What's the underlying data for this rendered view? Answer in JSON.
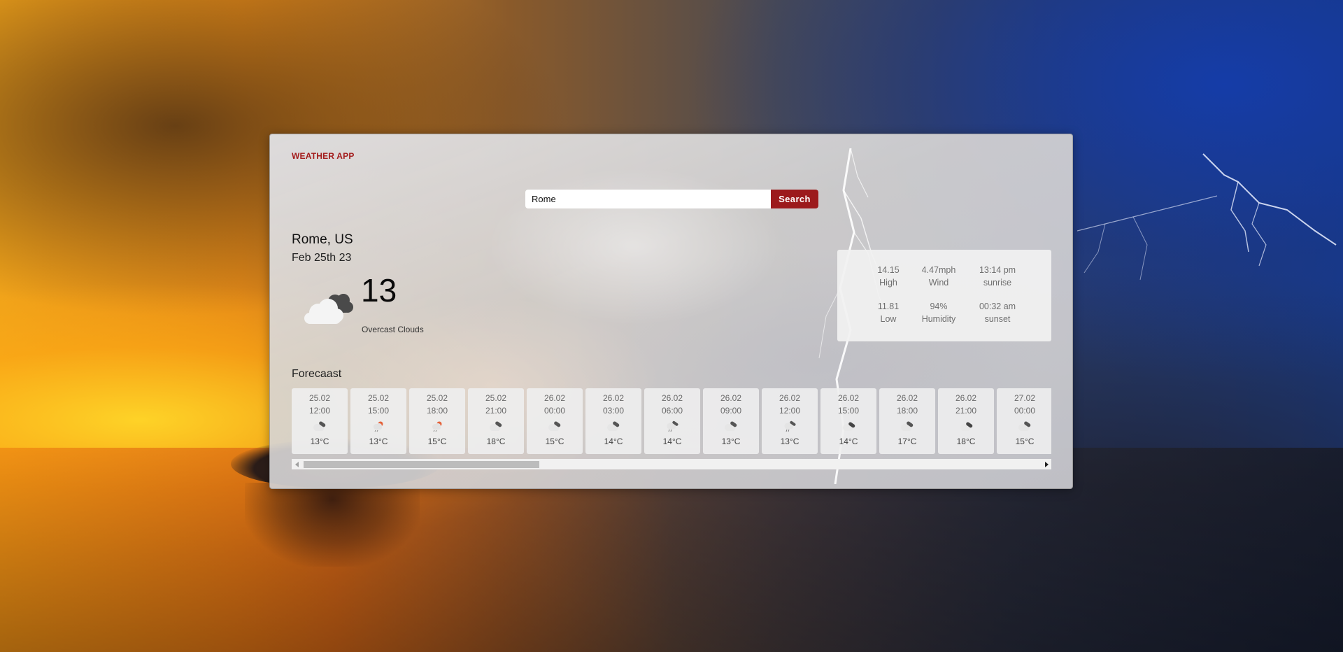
{
  "app": {
    "title": "WEATHER APP"
  },
  "search": {
    "value": "Rome",
    "button_label": "Search"
  },
  "current": {
    "location": "Rome, US",
    "date": "Feb 25th 23",
    "temperature": "13",
    "condition": "Overcast Clouds",
    "icon": "overcast-clouds-icon"
  },
  "details": {
    "high": {
      "value": "14.15",
      "label": "High"
    },
    "wind": {
      "value": "4.47mph",
      "label": "Wind"
    },
    "sunrise": {
      "value": "13:14 pm",
      "label": "sunrise"
    },
    "low": {
      "value": "11.81",
      "label": "Low"
    },
    "humidity": {
      "value": "94%",
      "label": "Humidity"
    },
    "sunset": {
      "value": "00:32 am",
      "label": "sunset"
    }
  },
  "forecast": {
    "title": "Forecaast",
    "items": [
      {
        "date": "25.02",
        "time": "12:00",
        "temp": "13°C",
        "icon": "broken-clouds-icon"
      },
      {
        "date": "25.02",
        "time": "15:00",
        "temp": "13°C",
        "icon": "light-rain-icon"
      },
      {
        "date": "25.02",
        "time": "18:00",
        "temp": "15°C",
        "icon": "light-rain-icon"
      },
      {
        "date": "25.02",
        "time": "21:00",
        "temp": "18°C",
        "icon": "broken-clouds-icon"
      },
      {
        "date": "26.02",
        "time": "00:00",
        "temp": "15°C",
        "icon": "broken-clouds-icon"
      },
      {
        "date": "26.02",
        "time": "03:00",
        "temp": "14°C",
        "icon": "broken-clouds-icon"
      },
      {
        "date": "26.02",
        "time": "06:00",
        "temp": "14°C",
        "icon": "rain-icon"
      },
      {
        "date": "26.02",
        "time": "09:00",
        "temp": "13°C",
        "icon": "broken-clouds-icon"
      },
      {
        "date": "26.02",
        "time": "12:00",
        "temp": "13°C",
        "icon": "rain-icon"
      },
      {
        "date": "26.02",
        "time": "15:00",
        "temp": "14°C",
        "icon": "overcast-clouds-icon"
      },
      {
        "date": "26.02",
        "time": "18:00",
        "temp": "17°C",
        "icon": "broken-clouds-icon"
      },
      {
        "date": "26.02",
        "time": "21:00",
        "temp": "18°C",
        "icon": "overcast-clouds-icon"
      },
      {
        "date": "27.02",
        "time": "00:00",
        "temp": "15°C",
        "icon": "broken-clouds-icon"
      }
    ]
  },
  "colors": {
    "accent": "#9c1a1c",
    "title": "#a31b1b"
  }
}
